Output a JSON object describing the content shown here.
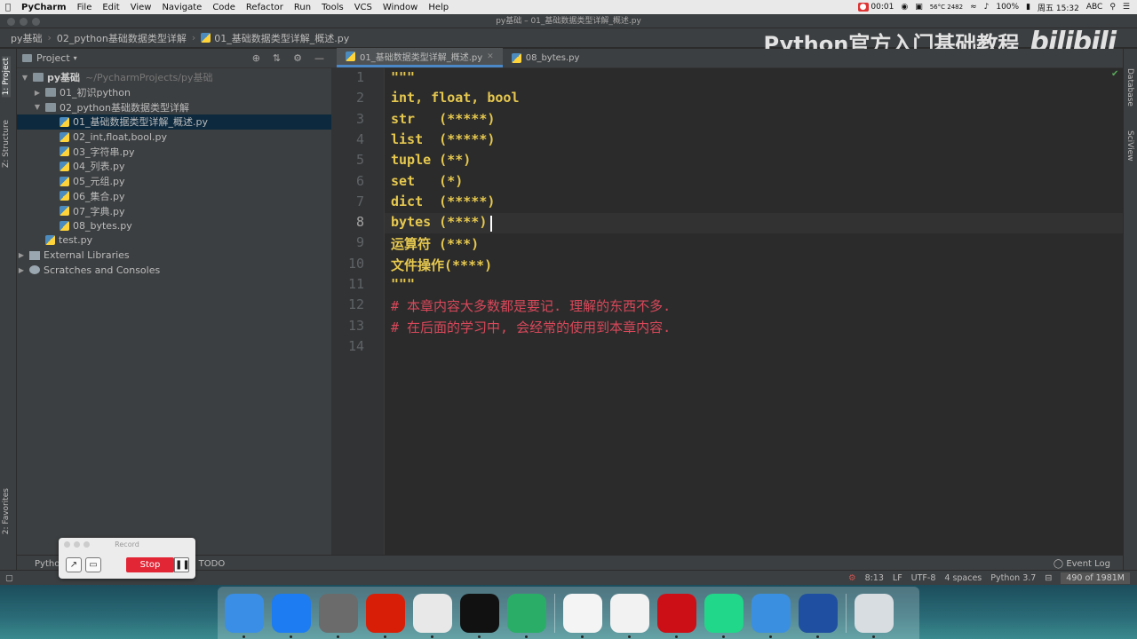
{
  "menubar": {
    "app": "PyCharm",
    "items": [
      "File",
      "Edit",
      "View",
      "Navigate",
      "Code",
      "Refactor",
      "Run",
      "Tools",
      "VCS",
      "Window",
      "Help"
    ],
    "rec_time": "00:01",
    "battery": "100%",
    "temp": "56°C 2482",
    "clock": "周五 15:32",
    "input": "ABC"
  },
  "window": {
    "title": "py基础 – 01_基础数据类型详解_概述.py"
  },
  "breadcrumb": [
    "py基础",
    "02_python基础数据类型详解",
    "01_基础数据类型详解_概述.py"
  ],
  "watermark": {
    "text": "Python官方入门基础教程",
    "logo": "bilibili"
  },
  "left_tabs": {
    "project": "1: Project",
    "structure": "Z: Structure",
    "favorites": "2: Favorites"
  },
  "right_tabs": {
    "database": "Database",
    "sciview": "SciView"
  },
  "project": {
    "header": "Project",
    "root": {
      "name": "py基础",
      "path": "~/PycharmProjects/py基础"
    },
    "folder1": "01_初识python",
    "folder2": "02_python基础数据类型详解",
    "files": [
      "01_基础数据类型详解_概述.py",
      "02_int,float,bool.py",
      "03_字符串.py",
      "04_列表.py",
      "05_元组.py",
      "06_集合.py",
      "07_字典.py",
      "08_bytes.py"
    ],
    "test": "test.py",
    "ext": "External Libraries",
    "scratch": "Scratches and Consoles"
  },
  "tabs": [
    "01_基础数据类型详解_概述.py",
    "08_bytes.py"
  ],
  "code": {
    "lines": [
      "\"\"\"",
      "int, float, bool",
      "str   (*****)",
      "list  (*****)",
      "tuple (**)",
      "set   (*)",
      "dict  (*****)",
      "bytes (****)",
      "运算符 (***)",
      "文件操作(****)",
      "\"\"\"",
      "# 本章内容大多数都是要记. 理解的东西不多.",
      "# 在后面的学习中, 会经常的使用到本章内容.",
      ""
    ],
    "line_numbers": [
      "1",
      "2",
      "3",
      "4",
      "5",
      "6",
      "7",
      "8",
      "9",
      "10",
      "11",
      "12",
      "13",
      "14"
    ]
  },
  "bottom": {
    "python_console": "Python",
    "todo": "TODO",
    "event_log": "Event Log"
  },
  "status": {
    "pos": "8:13",
    "lf": "LF",
    "enc": "UTF-8",
    "indent": "4 spaces",
    "interp": "Python 3.7",
    "mem": "490 of 1981M"
  },
  "record": {
    "title": "Record",
    "stop": "Stop"
  },
  "dock": [
    {
      "name": "Finder",
      "color": "#3a8ee6"
    },
    {
      "name": "Safari",
      "color": "#1d7cf2"
    },
    {
      "name": "Launchpad",
      "color": "#6b6b6b"
    },
    {
      "name": "NetEase Music",
      "color": "#d81e06"
    },
    {
      "name": "Chrome",
      "color": "#e8e8e8"
    },
    {
      "name": "QQ",
      "color": "#111111"
    },
    {
      "name": "WeChat",
      "color": "#2aae67"
    },
    {
      "name": "Baidu Netdisk",
      "color": "#f4f4f4"
    },
    {
      "name": "Typora",
      "color": "#f2f2f2"
    },
    {
      "name": "Opera",
      "color": "#cc0f16"
    },
    {
      "name": "PyCharm",
      "color": "#21d789"
    },
    {
      "name": "Paw",
      "color": "#3b8fe0"
    },
    {
      "name": "Thunder",
      "color": "#1f4fa0"
    },
    {
      "name": "Trash",
      "color": "#d8dde2"
    }
  ]
}
